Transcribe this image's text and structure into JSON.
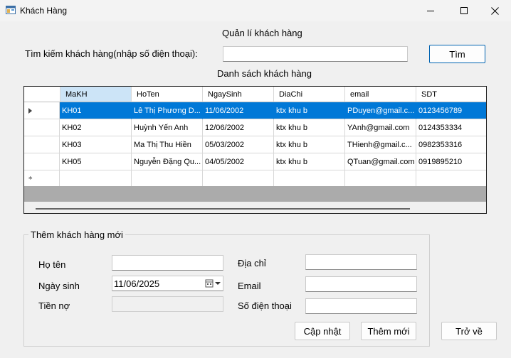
{
  "window": {
    "title": "Khách Hàng"
  },
  "header": {
    "title": "Quản lí khách hàng"
  },
  "search": {
    "label": "Tìm kiếm khách hàng(nhập số điện thoại):",
    "value": "",
    "button": "Tìm"
  },
  "grid": {
    "title": "Danh sách khách hàng",
    "columns": [
      "MaKH",
      "HoTen",
      "NgaySinh",
      "DiaChi",
      "email",
      "SDT"
    ],
    "rows": [
      [
        "KH01",
        "Lê Thị Phương D...",
        "11/06/2002",
        "ktx khu b",
        "PDuyen@gmail.c...",
        "0123456789"
      ],
      [
        "KH02",
        "Huỳnh Yến Anh",
        "12/06/2002",
        "ktx khu b",
        "YAnh@gmail.com",
        "0124353334"
      ],
      [
        "KH03",
        "Ma Thị Thu Hiền",
        "05/03/2002",
        "ktx khu b",
        "THienh@gmail.c...",
        "0982353316"
      ],
      [
        "KH05",
        "Nguyễn Đặng Qu...",
        "04/05/2002",
        "ktx khu b",
        "QTuan@gmail.com",
        "0919895210"
      ]
    ],
    "selected_row": 0
  },
  "form": {
    "legend": "Thêm khách hàng mới",
    "name_label": "Họ tên",
    "name_value": "",
    "dob_label": "Ngày sinh",
    "dob_value": "11/06/2025",
    "debt_label": "Tiền nợ",
    "debt_value": "",
    "address_label": "Địa chỉ",
    "address_value": "",
    "email_label": "Email",
    "email_value": "",
    "phone_label": "Số điện thoại",
    "phone_value": "",
    "update_button": "Cập nhật",
    "add_button": "Thêm mới"
  },
  "back_button": "Trở về",
  "colors": {
    "selection": "#0078d7",
    "header_selected": "#cce4f7",
    "grid_empty": "#ababab"
  }
}
